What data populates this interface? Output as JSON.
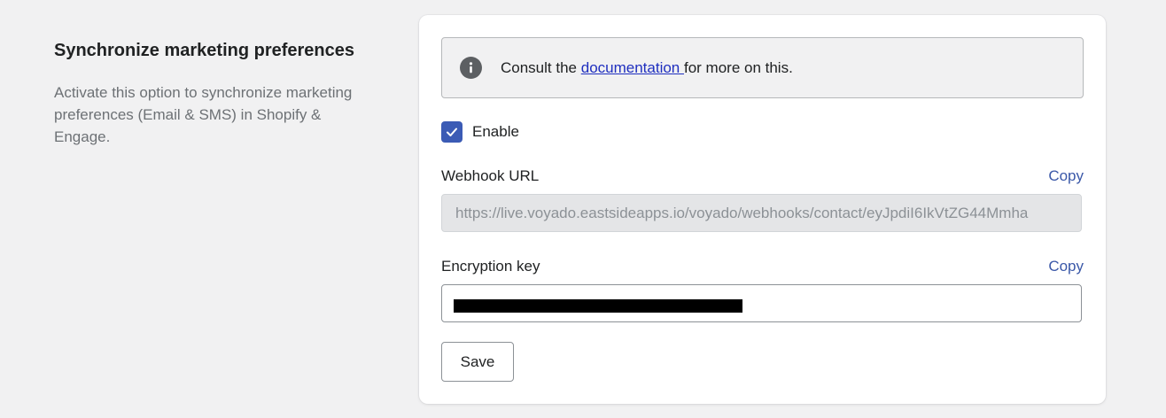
{
  "section": {
    "title": "Synchronize marketing preferences",
    "description": "Activate this option to synchronize marketing preferences (Email & SMS) in Shopify & Engage."
  },
  "banner": {
    "icon": "info-icon",
    "text_before": "Consult the ",
    "link_text": "documentation ",
    "text_after": "for more on this."
  },
  "enable": {
    "label": "Enable",
    "checked": true
  },
  "webhook": {
    "label": "Webhook URL",
    "copy_label": "Copy",
    "value": "https://live.voyado.eastsideapps.io/voyado/webhooks/contact/eyJpdiI6IkVtZG44Mmha"
  },
  "encryption": {
    "label": "Encryption key",
    "copy_label": "Copy",
    "value_redacted": true
  },
  "actions": {
    "save_label": "Save"
  },
  "colors": {
    "accent": "#3b5bb5",
    "link": "#1f2fbf",
    "page_background": "#f1f1f2"
  }
}
